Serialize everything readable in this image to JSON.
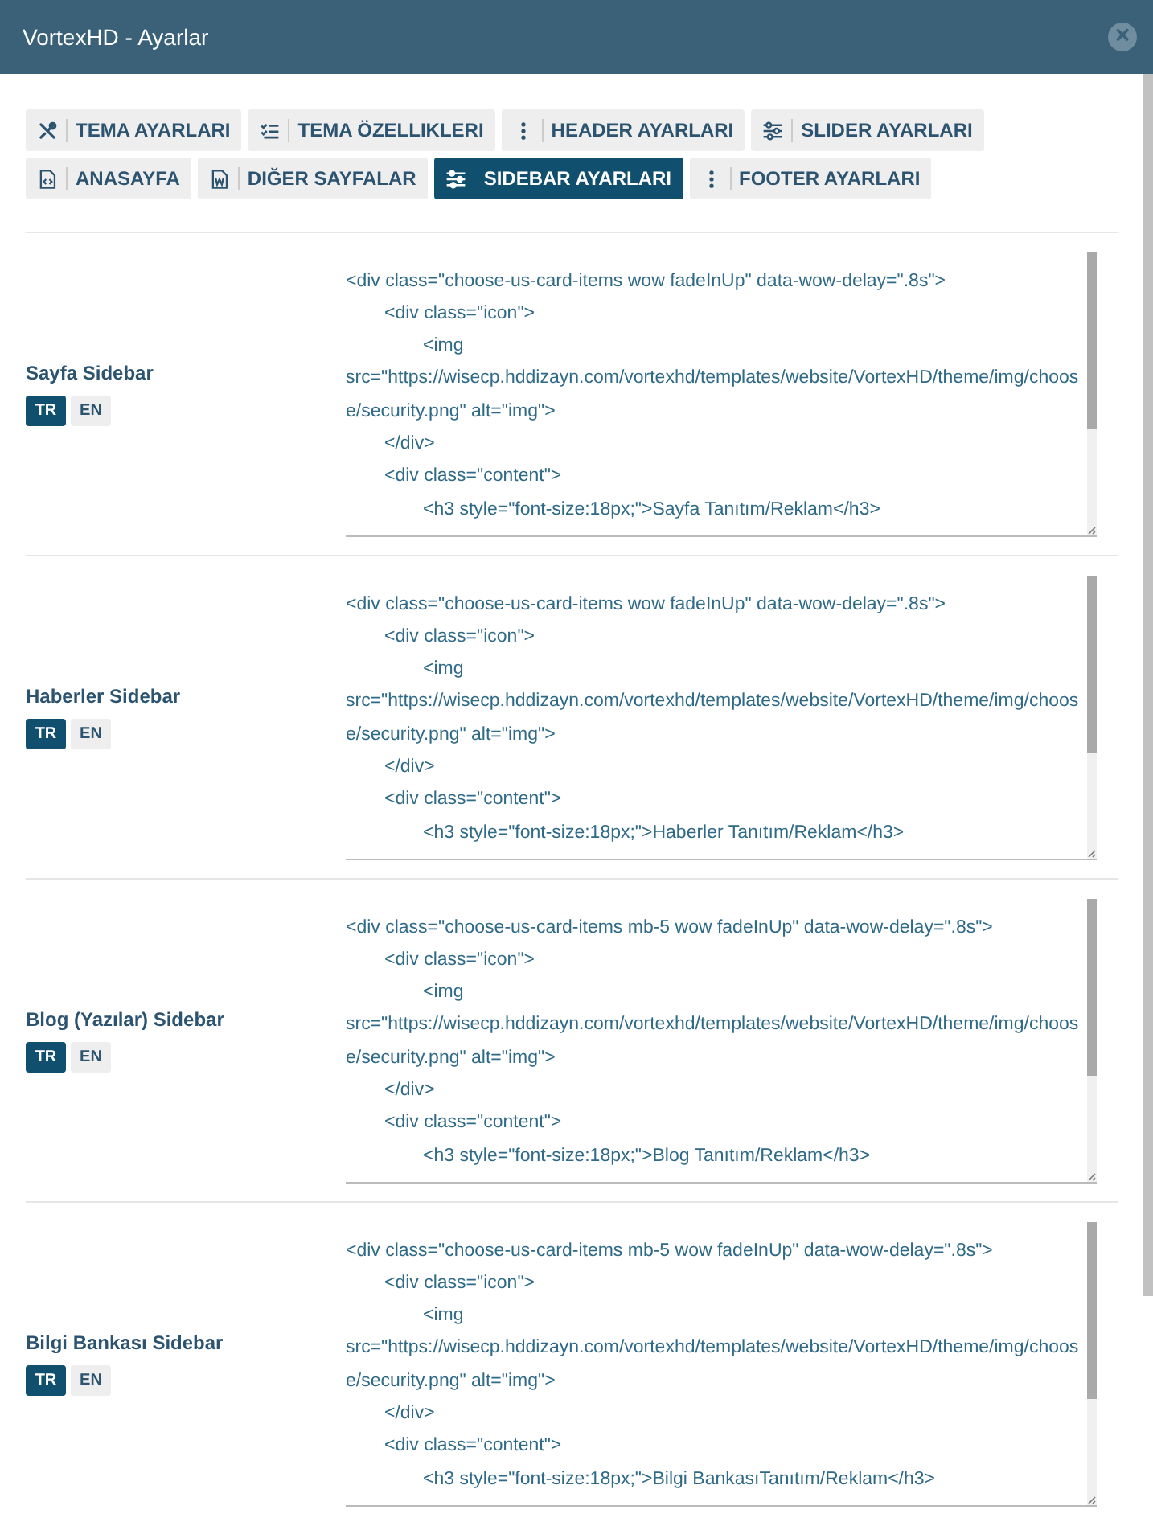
{
  "window": {
    "title": "VortexHD - Ayarlar",
    "close": "×"
  },
  "tabs": [
    {
      "label": "TEMA AYARLARI",
      "selected": false
    },
    {
      "label": "TEMA ÖZELLIKLERI",
      "selected": false
    },
    {
      "label": "HEADER AYARLARI",
      "selected": false
    },
    {
      "label": "SLIDER AYARLARI",
      "selected": false
    },
    {
      "label": "ANASAYFA",
      "selected": false
    },
    {
      "label": "DIĞER SAYFALAR",
      "selected": false
    },
    {
      "label": "SIDEBAR AYARLARI",
      "selected": true
    },
    {
      "label": "FOOTER AYARLARI",
      "selected": false
    }
  ],
  "sections": [
    {
      "label": "Sayfa Sidebar",
      "languages": [
        {
          "label": "TR",
          "selected": true
        },
        {
          "label": "EN",
          "selected": false
        }
      ],
      "code": [
        {
          "kind": "outer",
          "text": "<div class=\"choose-us-card-items wow fadeInUp\" data-wow-delay=\".8s\">"
        },
        {
          "kind": "inner",
          "text": "<div class=\"icon\">"
        },
        {
          "kind": "deep",
          "text": "<img"
        },
        {
          "kind": "outer",
          "text": "src=\"https://wisecp.hddizayn.com/vortexhd/templates/website/VortexHD/theme/img/choose/security.png\" alt=\"img\">"
        },
        {
          "kind": "inner",
          "text": "</div>"
        },
        {
          "kind": "inner",
          "text": "<div class=\"content\">"
        },
        {
          "kind": "deep",
          "text": "<h3 style=\"font-size:18px;\">Sayfa Tanıtım/Reklam</h3>"
        }
      ]
    },
    {
      "label": "Haberler Sidebar",
      "languages": [
        {
          "label": "TR",
          "selected": true
        },
        {
          "label": "EN",
          "selected": false
        }
      ],
      "code": [
        {
          "kind": "outer",
          "text": "<div class=\"choose-us-card-items wow fadeInUp\" data-wow-delay=\".8s\">"
        },
        {
          "kind": "inner",
          "text": "<div class=\"icon\">"
        },
        {
          "kind": "deep",
          "text": "<img"
        },
        {
          "kind": "outer",
          "text": "src=\"https://wisecp.hddizayn.com/vortexhd/templates/website/VortexHD/theme/img/choose/security.png\" alt=\"img\">"
        },
        {
          "kind": "inner",
          "text": "</div>"
        },
        {
          "kind": "inner",
          "text": "<div class=\"content\">"
        },
        {
          "kind": "deep",
          "text": "<h3 style=\"font-size:18px;\">Haberler Tanıtım/Reklam</h3>"
        }
      ]
    },
    {
      "label": "Blog (Yazılar) Sidebar",
      "languages": [
        {
          "label": "TR",
          "selected": true
        },
        {
          "label": "EN",
          "selected": false
        }
      ],
      "code": [
        {
          "kind": "outer",
          "text": "<div class=\"choose-us-card-items mb-5 wow fadeInUp\" data-wow-delay=\".8s\">"
        },
        {
          "kind": "inner",
          "text": "<div class=\"icon\">"
        },
        {
          "kind": "deep",
          "text": "<img"
        },
        {
          "kind": "outer",
          "text": "src=\"https://wisecp.hddizayn.com/vortexhd/templates/website/VortexHD/theme/img/choose/security.png\" alt=\"img\">"
        },
        {
          "kind": "inner",
          "text": "</div>"
        },
        {
          "kind": "inner",
          "text": "<div class=\"content\">"
        },
        {
          "kind": "deep",
          "text": "<h3 style=\"font-size:18px;\">Blog Tanıtım/Reklam</h3>"
        }
      ]
    },
    {
      "label": "Bilgi Bankası Sidebar",
      "languages": [
        {
          "label": "TR",
          "selected": true
        },
        {
          "label": "EN",
          "selected": false
        }
      ],
      "code": [
        {
          "kind": "outer",
          "text": "<div class=\"choose-us-card-items mb-5 wow fadeInUp\" data-wow-delay=\".8s\">"
        },
        {
          "kind": "inner",
          "text": "<div class=\"icon\">"
        },
        {
          "kind": "deep",
          "text": "<img"
        },
        {
          "kind": "outer",
          "text": "src=\"https://wisecp.hddizayn.com/vortexhd/templates/website/VortexHD/theme/img/choose/security.png\" alt=\"img\">"
        },
        {
          "kind": "inner",
          "text": "</div>"
        },
        {
          "kind": "inner",
          "text": "<div class=\"content\">"
        },
        {
          "kind": "deep",
          "text": "<h3 style=\"font-size:18px;\">Bilgi BankasıTanıtım/Reklam</h3>"
        }
      ]
    }
  ]
}
